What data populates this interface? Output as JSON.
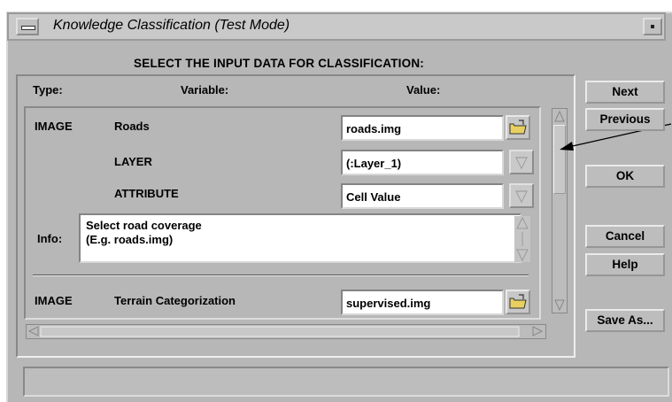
{
  "window": {
    "title": "Knowledge Classification (Test Mode)"
  },
  "heading": "SELECT THE INPUT DATA FOR CLASSIFICATION:",
  "columns": {
    "type": "Type:",
    "variable": "Variable:",
    "value": "Value:"
  },
  "rows": [
    {
      "type": "IMAGE",
      "variable": "Roads",
      "value": "roads.img"
    },
    {
      "type": "",
      "variable": "LAYER",
      "value": "(:Layer_1)"
    },
    {
      "type": "",
      "variable": "ATTRIBUTE",
      "value": "Cell Value"
    }
  ],
  "info": {
    "label": "Info:",
    "line1": "Select road coverage",
    "line2": "(E.g. roads.img)"
  },
  "row2": {
    "type": "IMAGE",
    "variable": "Terrain Categorization",
    "value": "supervised.img"
  },
  "buttons": {
    "next": "Next",
    "previous": "Previous",
    "ok": "OK",
    "cancel": "Cancel",
    "help": "Help",
    "save_as": "Save As..."
  },
  "icons": {
    "window_menu": "window-menu-icon",
    "minimize": "minimize-icon",
    "file_chooser": "open-folder-icon",
    "dropdown": "triangle-down-icon",
    "pointer_arrow": "arrow-icon"
  },
  "colors": {
    "panel": "#b7b7b7",
    "field": "#ffffff",
    "folder": "#e8d060"
  }
}
